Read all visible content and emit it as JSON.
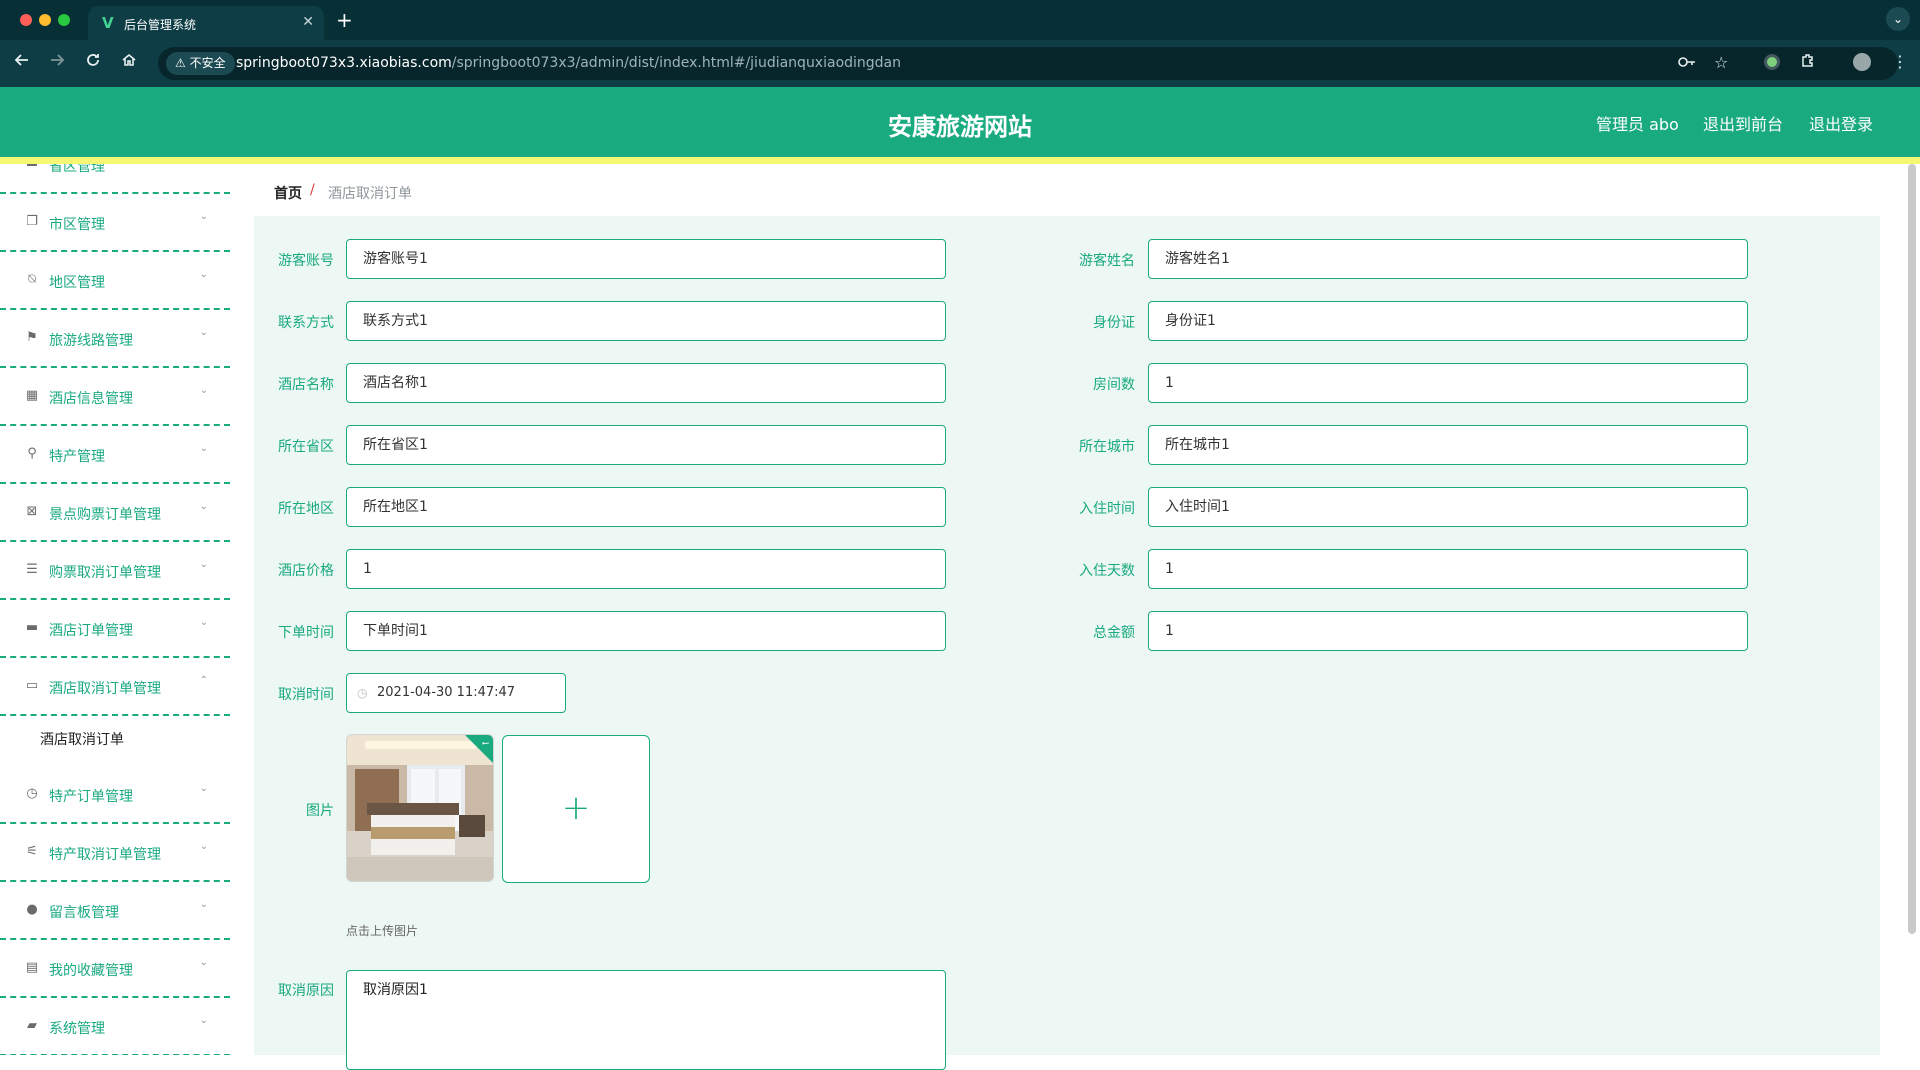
{
  "browser": {
    "tab_title": "后台管理系统",
    "tab_logo": "V",
    "close_glyph": "✕",
    "new_tab_glyph": "+",
    "tab_menu_glyph": "⌄",
    "insecure_label": "不安全",
    "url_domain": "springboot073x3.xiaobias.com",
    "url_path": "/springboot073x3/admin/dist/index.html#/jiudianquxiaodingdan",
    "icons": [
      "back-icon",
      "forward-icon",
      "reload-icon",
      "home-icon",
      "warning-icon",
      "key-icon",
      "star-icon",
      "extensions-icon",
      "profile-icon",
      "menu-icon"
    ]
  },
  "header": {
    "title": "安康旅游网站",
    "admin_label": "管理员 abo",
    "to_front_label": "退出到前台",
    "logout_label": "退出登录",
    "color": "#1aaa7f"
  },
  "sidebar": {
    "partial_top_label": "省区管理",
    "items": [
      {
        "label": "市区管理",
        "icon": "copy-icon",
        "glyph": "❐",
        "arrow": "⌄"
      },
      {
        "label": "地区管理",
        "icon": "bell-off-icon",
        "glyph": "⍉",
        "arrow": "⌄"
      },
      {
        "label": "旅游线路管理",
        "icon": "flag-icon",
        "glyph": "⚑",
        "arrow": "⌄"
      },
      {
        "label": "酒店信息管理",
        "icon": "grid-icon",
        "glyph": "▦",
        "arrow": "⌄"
      },
      {
        "label": "特产管理",
        "icon": "microphone-icon",
        "glyph": "⚲",
        "arrow": "⌄"
      },
      {
        "label": "景点购票订单管理",
        "icon": "clipboard-x-icon",
        "glyph": "⊠",
        "arrow": "⌄"
      },
      {
        "label": "购票取消订单管理",
        "icon": "list-icon",
        "glyph": "☰",
        "arrow": "⌄"
      },
      {
        "label": "酒店订单管理",
        "icon": "monitor-icon",
        "glyph": "▬",
        "arrow": "⌄"
      },
      {
        "label": "酒店取消订单管理",
        "icon": "tray-icon",
        "glyph": "▭",
        "arrow": "⌃"
      },
      {
        "label": "特产订单管理",
        "icon": "clock-icon",
        "glyph": "◷",
        "arrow": "⌄"
      },
      {
        "label": "特产取消订单管理",
        "icon": "sliders-icon",
        "glyph": "⚟",
        "arrow": "⌄"
      },
      {
        "label": "留言板管理",
        "icon": "lightbulb-icon",
        "glyph": "●",
        "arrow": "⌄"
      },
      {
        "label": "我的收藏管理",
        "icon": "document-icon",
        "glyph": "▤",
        "arrow": "⌄"
      },
      {
        "label": "系统管理",
        "icon": "ticket-icon",
        "glyph": "▰",
        "arrow": "⌄"
      }
    ],
    "submenu_active": "酒店取消订单"
  },
  "breadcrumb": {
    "home": "首页",
    "separator": "/",
    "current": "酒店取消订单"
  },
  "form": {
    "fields": [
      {
        "label": "游客账号",
        "value": "游客账号1"
      },
      {
        "label": "游客姓名",
        "value": "游客姓名1"
      },
      {
        "label": "联系方式",
        "value": "联系方式1"
      },
      {
        "label": "身份证",
        "value": "身份证1"
      },
      {
        "label": "酒店名称",
        "value": "酒店名称1"
      },
      {
        "label": "房间数",
        "value": "1"
      },
      {
        "label": "所在省区",
        "value": "所在省区1"
      },
      {
        "label": "所在城市",
        "value": "所在城市1"
      },
      {
        "label": "所在地区",
        "value": "所在地区1"
      },
      {
        "label": "入住时间",
        "value": "入住时间1"
      },
      {
        "label": "酒店价格",
        "value": "1"
      },
      {
        "label": "入住天数",
        "value": "1"
      },
      {
        "label": "下单时间",
        "value": "下单时间1"
      },
      {
        "label": "总金额",
        "value": "1"
      }
    ],
    "cancel_time_label": "取消时间",
    "cancel_time_value": "2021-04-30 11:47:47",
    "clock_glyph": "◷",
    "image_label": "图片",
    "upload_plus": "+",
    "upload_check": "✓",
    "upload_hint": "点击上传图片",
    "reason_label": "取消原因",
    "reason_value": "取消原因1"
  }
}
